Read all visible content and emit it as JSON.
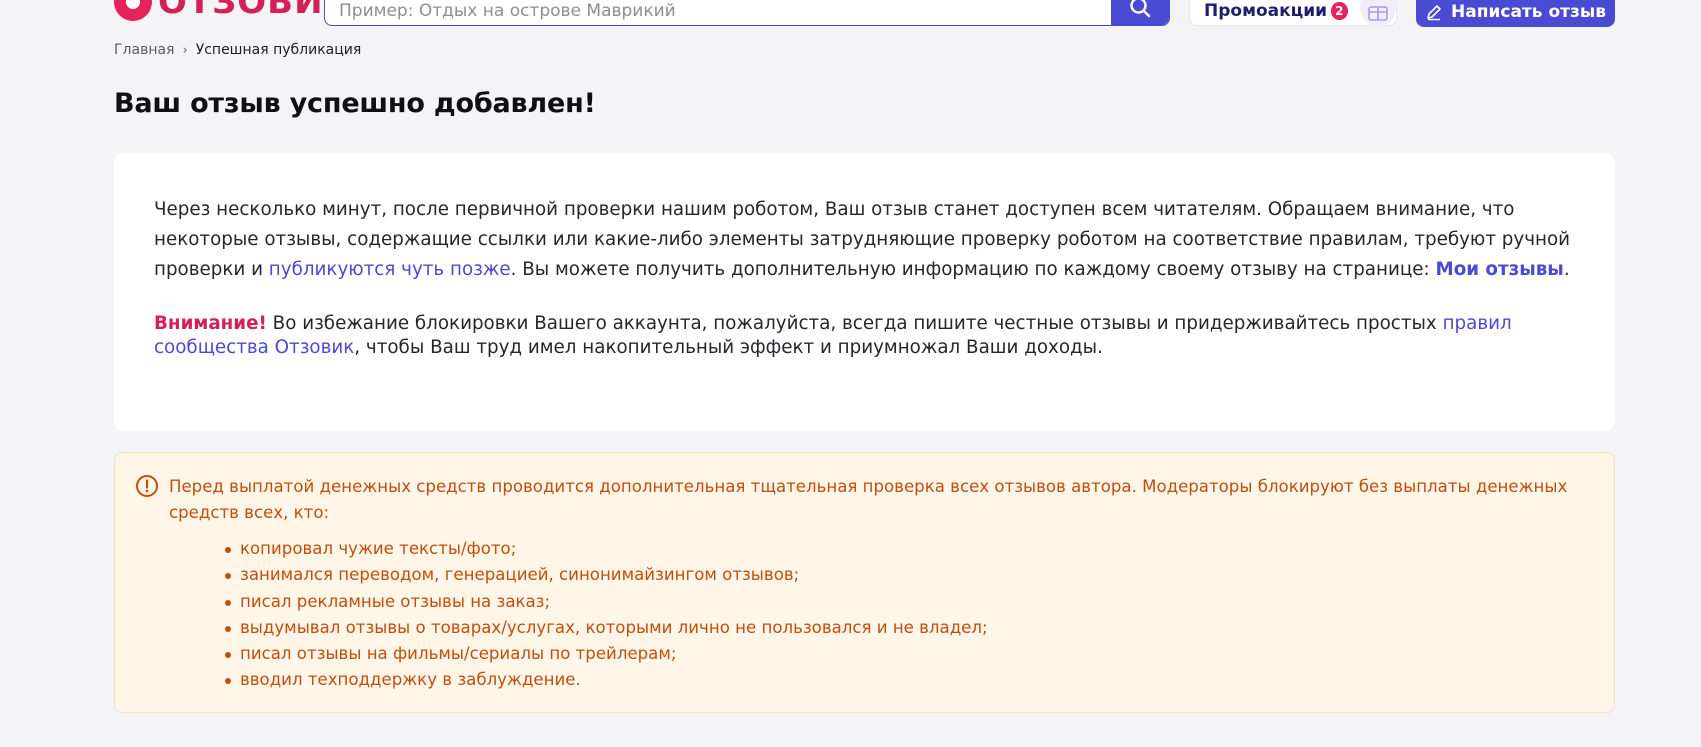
{
  "header": {
    "logo_text": "ОТЗОВИК",
    "search_placeholder": "Пример: Отдых на острове Маврикий",
    "promo_label": "Промоакции",
    "promo_count": "2",
    "write_label": "Написать отзыв"
  },
  "breadcrumb": {
    "home": "Главная",
    "separator": "›",
    "current": "Успешная публикация"
  },
  "page_title": "Ваш отзыв успешно добавлен!",
  "notice": {
    "text_1": "Через несколько минут, после первичной проверки нашим роботом, Ваш отзыв станет доступен всем читателям. Обращаем внимание, что некоторые отзывы, содержащие ссылки или какие-либо элементы затрудняющие проверку роботом на соответствие правилам, требуют ручной проверки и ",
    "link_later": "публикуются чуть позже",
    "text_2": ". Вы можете получить дополнительную информацию по каждому своему отзыву на странице: ",
    "link_my_reviews": "Мои отзывы",
    "text_3": ".",
    "attention_label": "Внимание!",
    "attention_text": " Во избежание блокировки Вашего аккаунта, пожалуйста, всегда пишите честные отзывы и придерживайтесь простых ",
    "link_rules": "правил сообщества Отзовик",
    "attention_tail": ", чтобы Ваш труд имел накопительный эффект и приумножал Ваши доходы."
  },
  "warning": {
    "intro": "Перед выплатой денежных средств проводится дополнительная тщательная проверка всех отзывов автора. Модераторы блокируют без выплаты денежных средств всех, кто:",
    "items": [
      "копировал чужие тексты/фото;",
      "занимался переводом, генерацией, синонимайзингом отзывов;",
      "писал рекламные отзывы на заказ;",
      "выдумывал отзывы о товарах/услугах, которыми лично не пользовался и не владел;",
      "писал отзывы на фильмы/сериалы по трейлерам;",
      "вводил техподдержку в заблуждение."
    ]
  },
  "icons": {
    "logo": "otzovik-logo-icon",
    "search": "search-icon",
    "gift": "gift-icon",
    "pencil": "pencil-icon",
    "warning": "exclamation-circle-icon"
  },
  "colors": {
    "brand_pink": "#d41f57",
    "accent_blue": "#4a4bd3",
    "warning_text": "#c24e0d",
    "warning_bg": "#fff6e7"
  }
}
